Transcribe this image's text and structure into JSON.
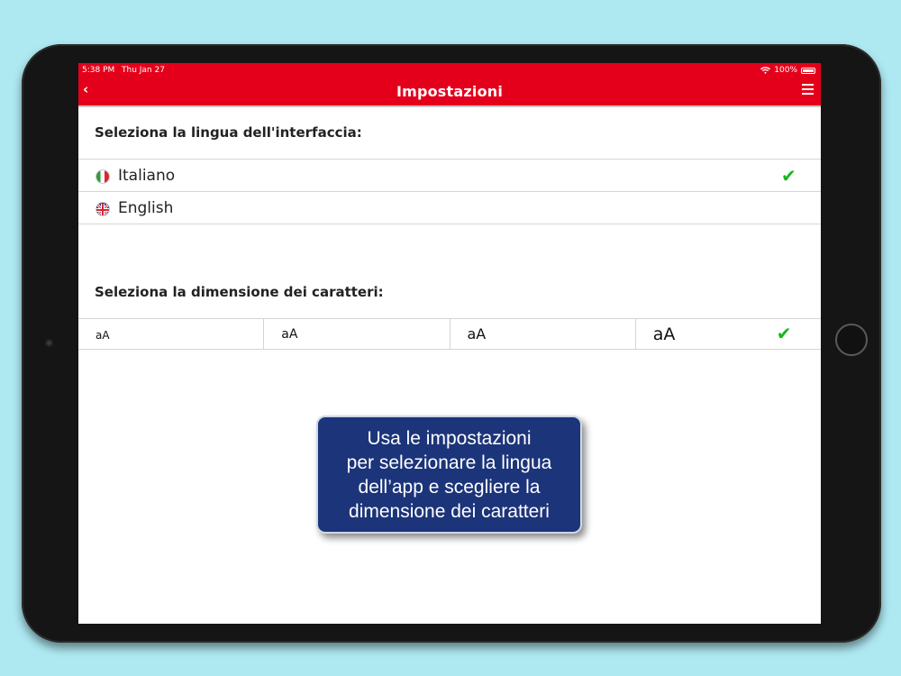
{
  "colors": {
    "accent": "#e4001b",
    "check": "#17b61d",
    "tooltip_bg": "#1c3479",
    "background": "#aee9f2"
  },
  "status_bar": {
    "time": "5:38 PM",
    "date": "Thu Jan 27",
    "battery": "100%"
  },
  "nav": {
    "back_icon": "chevron-left-icon",
    "title": "Impostazioni",
    "menu_icon": "hamburger-menu-icon"
  },
  "language_section": {
    "title": "Seleziona la lingua dell'interfaccia:",
    "options": [
      {
        "label": "Italiano",
        "flag": "italy-flag-icon",
        "selected": true
      },
      {
        "label": "English",
        "flag": "uk-flag-icon",
        "selected": false
      }
    ]
  },
  "font_size_section": {
    "title": "Seleziona la dimensione dei caratteri:",
    "options": [
      {
        "label": "aA",
        "selected": false
      },
      {
        "label": "aA",
        "selected": false
      },
      {
        "label": "aA",
        "selected": false
      },
      {
        "label": "aA",
        "selected": true
      }
    ]
  },
  "tooltip": {
    "lines": [
      "Usa le impostazioni",
      "per selezionare la lingua",
      "dell’app e scegliere la",
      "dimensione dei caratteri"
    ]
  }
}
